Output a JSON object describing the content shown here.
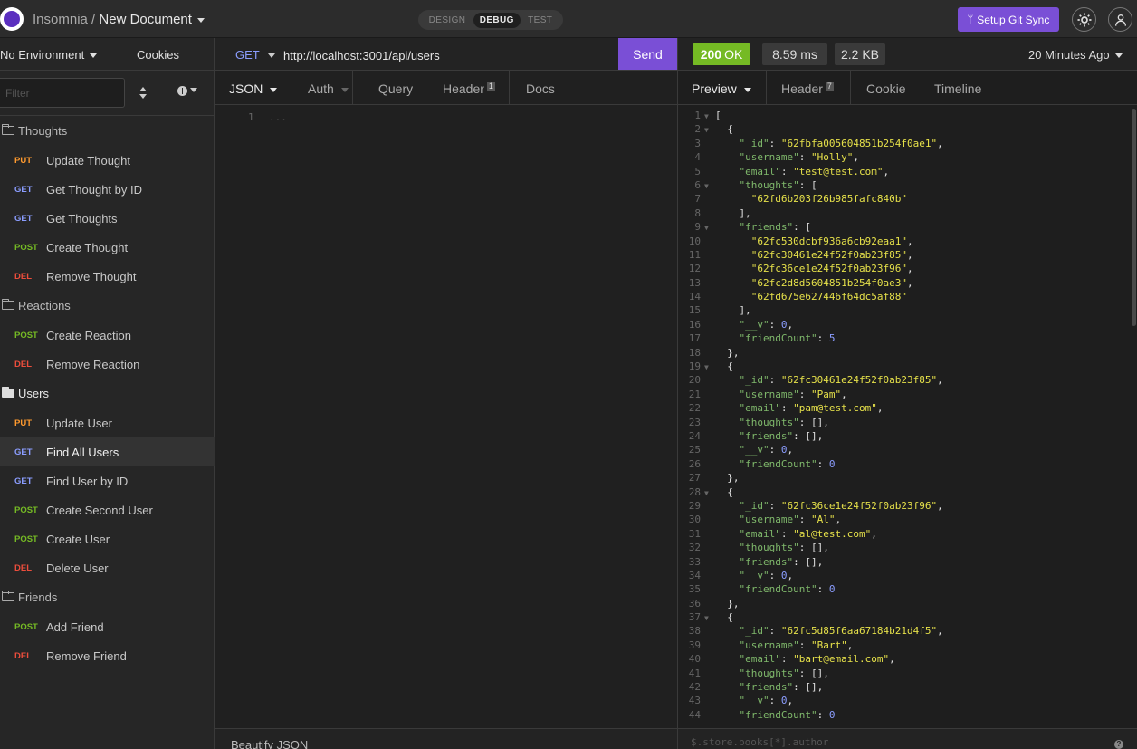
{
  "app": {
    "name": "Insomnia",
    "separator": "/",
    "document": "New Document",
    "modes": [
      "DESIGN",
      "DEBUG",
      "TEST"
    ],
    "git_sync": "Setup Git Sync",
    "accent": "#7a4fd6"
  },
  "sidebar": {
    "environment": "No Environment",
    "cookies": "Cookies",
    "filter_placeholder": "Filter",
    "tree": [
      {
        "type": "folder",
        "label": "Thoughts",
        "open": false
      },
      {
        "type": "request",
        "method": "PUT",
        "label": "Update Thought"
      },
      {
        "type": "request",
        "method": "GET",
        "label": "Get Thought by ID"
      },
      {
        "type": "request",
        "method": "GET",
        "label": "Get Thoughts"
      },
      {
        "type": "request",
        "method": "POST",
        "label": "Create Thought"
      },
      {
        "type": "request",
        "method": "DEL",
        "label": "Remove Thought"
      },
      {
        "type": "folder",
        "label": "Reactions",
        "open": false
      },
      {
        "type": "request",
        "method": "POST",
        "label": "Create Reaction"
      },
      {
        "type": "request",
        "method": "DEL",
        "label": "Remove Reaction"
      },
      {
        "type": "folder",
        "label": "Users",
        "open": true
      },
      {
        "type": "request",
        "method": "PUT",
        "label": "Update User"
      },
      {
        "type": "request",
        "method": "GET",
        "label": "Find All Users",
        "active": true
      },
      {
        "type": "request",
        "method": "GET",
        "label": "Find User by ID"
      },
      {
        "type": "request",
        "method": "POST",
        "label": "Create Second User"
      },
      {
        "type": "request",
        "method": "POST",
        "label": "Create User"
      },
      {
        "type": "request",
        "method": "DEL",
        "label": "Delete User"
      },
      {
        "type": "folder",
        "label": "Friends",
        "open": false
      },
      {
        "type": "request",
        "method": "POST",
        "label": "Add Friend"
      },
      {
        "type": "request",
        "method": "DEL",
        "label": "Remove Friend"
      }
    ]
  },
  "request": {
    "method": "GET",
    "url": "http://localhost:3001/api/users",
    "send": "Send",
    "tabs": {
      "body": "JSON",
      "auth": "Auth",
      "query": "Query",
      "header": "Header",
      "header_count": "1",
      "docs": "Docs"
    },
    "body_line": "1",
    "body_placeholder": "...",
    "footer": "Beautify JSON"
  },
  "response": {
    "status_code": "200",
    "status_text": "OK",
    "time": "8.59 ms",
    "size": "2.2 KB",
    "ago": "20 Minutes Ago",
    "tabs": {
      "preview": "Preview",
      "header": "Header",
      "header_count": "7",
      "cookie": "Cookie",
      "timeline": "Timeline"
    },
    "jsonpath_placeholder": "$.store.books[*].author",
    "help": "?",
    "body": [
      {
        "n": "1",
        "fold": true,
        "t": [
          [
            "p",
            "["
          ]
        ]
      },
      {
        "n": "2",
        "fold": true,
        "t": [
          [
            "p",
            "  {"
          ]
        ]
      },
      {
        "n": "3",
        "t": [
          [
            "p",
            "    "
          ],
          [
            "k",
            "\"_id\""
          ],
          [
            "p",
            ": "
          ],
          [
            "s",
            "\"62fbfa005604851b254f0ae1\""
          ],
          [
            "p",
            ","
          ]
        ]
      },
      {
        "n": "4",
        "t": [
          [
            "p",
            "    "
          ],
          [
            "k",
            "\"username\""
          ],
          [
            "p",
            ": "
          ],
          [
            "s",
            "\"Holly\""
          ],
          [
            "p",
            ","
          ]
        ]
      },
      {
        "n": "5",
        "t": [
          [
            "p",
            "    "
          ],
          [
            "k",
            "\"email\""
          ],
          [
            "p",
            ": "
          ],
          [
            "s",
            "\"test@test.com\""
          ],
          [
            "p",
            ","
          ]
        ]
      },
      {
        "n": "6",
        "fold": true,
        "t": [
          [
            "p",
            "    "
          ],
          [
            "k",
            "\"thoughts\""
          ],
          [
            "p",
            ": ["
          ]
        ]
      },
      {
        "n": "7",
        "t": [
          [
            "p",
            "      "
          ],
          [
            "s",
            "\"62fd6b203f26b985fafc840b\""
          ]
        ]
      },
      {
        "n": "8",
        "t": [
          [
            "p",
            "    ],"
          ]
        ]
      },
      {
        "n": "9",
        "fold": true,
        "t": [
          [
            "p",
            "    "
          ],
          [
            "k",
            "\"friends\""
          ],
          [
            "p",
            ": ["
          ]
        ]
      },
      {
        "n": "10",
        "t": [
          [
            "p",
            "      "
          ],
          [
            "s",
            "\"62fc530dcbf936a6cb92eaa1\""
          ],
          [
            "p",
            ","
          ]
        ]
      },
      {
        "n": "11",
        "t": [
          [
            "p",
            "      "
          ],
          [
            "s",
            "\"62fc30461e24f52f0ab23f85\""
          ],
          [
            "p",
            ","
          ]
        ]
      },
      {
        "n": "12",
        "t": [
          [
            "p",
            "      "
          ],
          [
            "s",
            "\"62fc36ce1e24f52f0ab23f96\""
          ],
          [
            "p",
            ","
          ]
        ]
      },
      {
        "n": "13",
        "t": [
          [
            "p",
            "      "
          ],
          [
            "s",
            "\"62fc2d8d5604851b254f0ae3\""
          ],
          [
            "p",
            ","
          ]
        ]
      },
      {
        "n": "14",
        "t": [
          [
            "p",
            "      "
          ],
          [
            "s",
            "\"62fd675e627446f64dc5af88\""
          ]
        ]
      },
      {
        "n": "15",
        "t": [
          [
            "p",
            "    ],"
          ]
        ]
      },
      {
        "n": "16",
        "t": [
          [
            "p",
            "    "
          ],
          [
            "k",
            "\"__v\""
          ],
          [
            "p",
            ": "
          ],
          [
            "n",
            "0"
          ],
          [
            "p",
            ","
          ]
        ]
      },
      {
        "n": "17",
        "t": [
          [
            "p",
            "    "
          ],
          [
            "k",
            "\"friendCount\""
          ],
          [
            "p",
            ": "
          ],
          [
            "n",
            "5"
          ]
        ]
      },
      {
        "n": "18",
        "t": [
          [
            "p",
            "  },"
          ]
        ]
      },
      {
        "n": "19",
        "fold": true,
        "t": [
          [
            "p",
            "  {"
          ]
        ]
      },
      {
        "n": "20",
        "t": [
          [
            "p",
            "    "
          ],
          [
            "k",
            "\"_id\""
          ],
          [
            "p",
            ": "
          ],
          [
            "s",
            "\"62fc30461e24f52f0ab23f85\""
          ],
          [
            "p",
            ","
          ]
        ]
      },
      {
        "n": "21",
        "t": [
          [
            "p",
            "    "
          ],
          [
            "k",
            "\"username\""
          ],
          [
            "p",
            ": "
          ],
          [
            "s",
            "\"Pam\""
          ],
          [
            "p",
            ","
          ]
        ]
      },
      {
        "n": "22",
        "t": [
          [
            "p",
            "    "
          ],
          [
            "k",
            "\"email\""
          ],
          [
            "p",
            ": "
          ],
          [
            "s",
            "\"pam@test.com\""
          ],
          [
            "p",
            ","
          ]
        ]
      },
      {
        "n": "23",
        "t": [
          [
            "p",
            "    "
          ],
          [
            "k",
            "\"thoughts\""
          ],
          [
            "p",
            ": [],"
          ]
        ]
      },
      {
        "n": "24",
        "t": [
          [
            "p",
            "    "
          ],
          [
            "k",
            "\"friends\""
          ],
          [
            "p",
            ": [],"
          ]
        ]
      },
      {
        "n": "25",
        "t": [
          [
            "p",
            "    "
          ],
          [
            "k",
            "\"__v\""
          ],
          [
            "p",
            ": "
          ],
          [
            "n",
            "0"
          ],
          [
            "p",
            ","
          ]
        ]
      },
      {
        "n": "26",
        "t": [
          [
            "p",
            "    "
          ],
          [
            "k",
            "\"friendCount\""
          ],
          [
            "p",
            ": "
          ],
          [
            "n",
            "0"
          ]
        ]
      },
      {
        "n": "27",
        "t": [
          [
            "p",
            "  },"
          ]
        ]
      },
      {
        "n": "28",
        "fold": true,
        "t": [
          [
            "p",
            "  {"
          ]
        ]
      },
      {
        "n": "29",
        "t": [
          [
            "p",
            "    "
          ],
          [
            "k",
            "\"_id\""
          ],
          [
            "p",
            ": "
          ],
          [
            "s",
            "\"62fc36ce1e24f52f0ab23f96\""
          ],
          [
            "p",
            ","
          ]
        ]
      },
      {
        "n": "30",
        "t": [
          [
            "p",
            "    "
          ],
          [
            "k",
            "\"username\""
          ],
          [
            "p",
            ": "
          ],
          [
            "s",
            "\"Al\""
          ],
          [
            "p",
            ","
          ]
        ]
      },
      {
        "n": "31",
        "t": [
          [
            "p",
            "    "
          ],
          [
            "k",
            "\"email\""
          ],
          [
            "p",
            ": "
          ],
          [
            "s",
            "\"al@test.com\""
          ],
          [
            "p",
            ","
          ]
        ]
      },
      {
        "n": "32",
        "t": [
          [
            "p",
            "    "
          ],
          [
            "k",
            "\"thoughts\""
          ],
          [
            "p",
            ": [],"
          ]
        ]
      },
      {
        "n": "33",
        "t": [
          [
            "p",
            "    "
          ],
          [
            "k",
            "\"friends\""
          ],
          [
            "p",
            ": [],"
          ]
        ]
      },
      {
        "n": "34",
        "t": [
          [
            "p",
            "    "
          ],
          [
            "k",
            "\"__v\""
          ],
          [
            "p",
            ": "
          ],
          [
            "n",
            "0"
          ],
          [
            "p",
            ","
          ]
        ]
      },
      {
        "n": "35",
        "t": [
          [
            "p",
            "    "
          ],
          [
            "k",
            "\"friendCount\""
          ],
          [
            "p",
            ": "
          ],
          [
            "n",
            "0"
          ]
        ]
      },
      {
        "n": "36",
        "t": [
          [
            "p",
            "  },"
          ]
        ]
      },
      {
        "n": "37",
        "fold": true,
        "t": [
          [
            "p",
            "  {"
          ]
        ]
      },
      {
        "n": "38",
        "t": [
          [
            "p",
            "    "
          ],
          [
            "k",
            "\"_id\""
          ],
          [
            "p",
            ": "
          ],
          [
            "s",
            "\"62fc5d85f6aa67184b21d4f5\""
          ],
          [
            "p",
            ","
          ]
        ]
      },
      {
        "n": "39",
        "t": [
          [
            "p",
            "    "
          ],
          [
            "k",
            "\"username\""
          ],
          [
            "p",
            ": "
          ],
          [
            "s",
            "\"Bart\""
          ],
          [
            "p",
            ","
          ]
        ]
      },
      {
        "n": "40",
        "t": [
          [
            "p",
            "    "
          ],
          [
            "k",
            "\"email\""
          ],
          [
            "p",
            ": "
          ],
          [
            "s",
            "\"bart@email.com\""
          ],
          [
            "p",
            ","
          ]
        ]
      },
      {
        "n": "41",
        "t": [
          [
            "p",
            "    "
          ],
          [
            "k",
            "\"thoughts\""
          ],
          [
            "p",
            ": [],"
          ]
        ]
      },
      {
        "n": "42",
        "t": [
          [
            "p",
            "    "
          ],
          [
            "k",
            "\"friends\""
          ],
          [
            "p",
            ": [],"
          ]
        ]
      },
      {
        "n": "43",
        "t": [
          [
            "p",
            "    "
          ],
          [
            "k",
            "\"__v\""
          ],
          [
            "p",
            ": "
          ],
          [
            "n",
            "0"
          ],
          [
            "p",
            ","
          ]
        ]
      },
      {
        "n": "44",
        "t": [
          [
            "p",
            "    "
          ],
          [
            "k",
            "\"friendCount\""
          ],
          [
            "p",
            ": "
          ],
          [
            "n",
            "0"
          ]
        ]
      }
    ]
  }
}
